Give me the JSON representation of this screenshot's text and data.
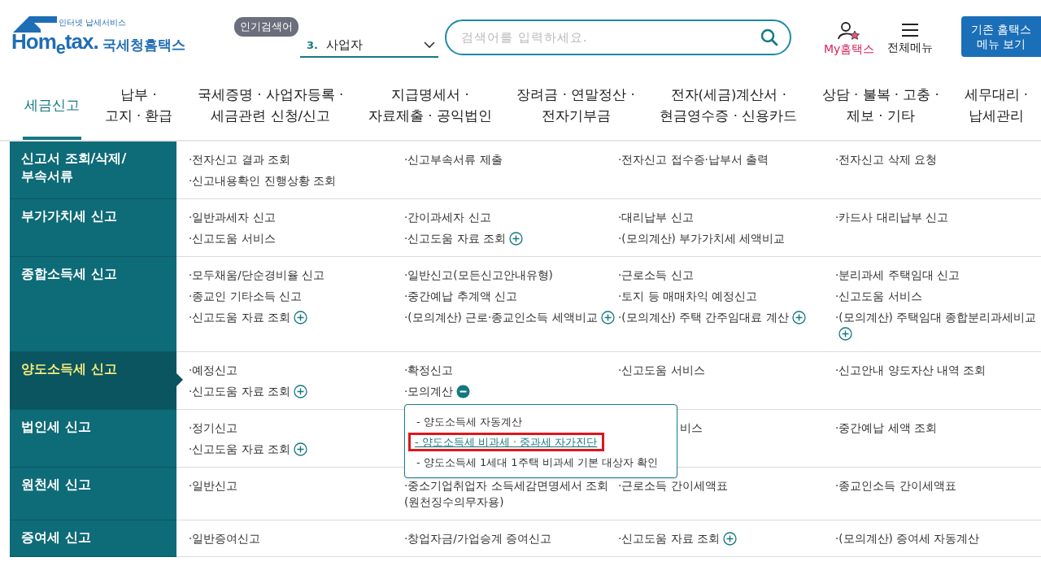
{
  "logo": {
    "tagline": "인터넷 납세서비스",
    "wordmark": "Hom$_{e}$tax.",
    "name": "국세청홈택스"
  },
  "popular": {
    "badge": "인기검색어",
    "rank": "3.",
    "term": "사업자"
  },
  "search": {
    "placeholder": "검색어를 입력하세요."
  },
  "my_link": "My홈택스",
  "menu_link": "전체메뉴",
  "legacy_button": "기존 홈택스\n메뉴 보기",
  "tabs": [
    {
      "label": "세금신고",
      "selected": true
    },
    {
      "label": "납부 ·\n고지 · 환급",
      "selected": false
    },
    {
      "label": "국세증명 · 사업자등록 ·\n세금관련 신청/신고",
      "selected": false
    },
    {
      "label": "지급명세서 ·\n자료제출 · 공익법인",
      "selected": false
    },
    {
      "label": "장려금 · 연말정산 ·\n전자기부금",
      "selected": false
    },
    {
      "label": "전자(세금)계산서 ·\n현금영수증 · 신용카드",
      "selected": false
    },
    {
      "label": "상담 · 불복 · 고충 ·\n제보 · 기타",
      "selected": false
    },
    {
      "label": "세무대리 ·\n납세관리",
      "selected": false
    }
  ],
  "sections": [
    {
      "title": "신고서 조회/삭제/\n부속서류",
      "selected": false,
      "columns": [
        [
          {
            "text": "·전자신고 결과 조회"
          },
          {
            "text": "·신고내용확인 진행상황 조회"
          }
        ],
        [
          {
            "text": "·신고부속서류 제출"
          }
        ],
        [
          {
            "text": "·전자신고 접수증·납부서 출력"
          }
        ],
        [
          {
            "text": "·전자신고 삭제 요청"
          }
        ]
      ]
    },
    {
      "title": "부가가치세 신고",
      "selected": false,
      "columns": [
        [
          {
            "text": "·일반과세자 신고"
          },
          {
            "text": "·신고도움 서비스"
          }
        ],
        [
          {
            "text": "·간이과세자 신고"
          },
          {
            "text": "·신고도움 자료 조회",
            "expanded": false
          }
        ],
        [
          {
            "text": "·대리납부 신고"
          },
          {
            "text": "·(모의계산) 부가가치세 세액비교"
          }
        ],
        [
          {
            "text": "·카드사 대리납부 신고"
          }
        ]
      ]
    },
    {
      "title": "종합소득세 신고",
      "selected": false,
      "columns": [
        [
          {
            "text": "·모두채움/단순경비율 신고"
          },
          {
            "text": "·종교인 기타소득 신고"
          },
          {
            "text": "·신고도움 자료 조회",
            "expanded": false
          }
        ],
        [
          {
            "text": "·일반신고(모든신고안내유형)"
          },
          {
            "text": "·중간예납 추계액 신고"
          },
          {
            "text": "·(모의계산) 근로·종교인소득 세액비교",
            "expanded": false
          }
        ],
        [
          {
            "text": "·근로소득 신고"
          },
          {
            "text": "·토지 등 매매차익 예정신고"
          },
          {
            "text": "·(모의계산) 주택 간주임대료 계산",
            "expanded": false
          }
        ],
        [
          {
            "text": "·분리과세 주택임대 신고"
          },
          {
            "text": "·신고도움 서비스"
          },
          {
            "text": "·(모의계산) 주택임대 종합분리과세비교",
            "expanded": false
          }
        ]
      ]
    },
    {
      "title": "양도소득세 신고",
      "selected": true,
      "columns": [
        [
          {
            "text": "·예정신고"
          },
          {
            "text": "·신고도움 자료 조회",
            "expanded": false
          }
        ],
        [
          {
            "text": "·확정신고"
          },
          {
            "text": "·모의계산",
            "expanded": true,
            "submenu": [
              {
                "text": "- 양도소득세 자동계산",
                "highlighted": false
              },
              {
                "text": "- 양도소득세 비과세 · 중과세 자가진단",
                "highlighted": true
              },
              {
                "text": "- 양도소득세 1세대 1주택 비과세 기본 대상자 확인",
                "highlighted": false
              }
            ]
          }
        ],
        [
          {
            "text": "·신고도움 서비스"
          }
        ],
        [
          {
            "text": "·신고안내 양도자산 내역 조회"
          }
        ]
      ]
    },
    {
      "title": "법인세 신고",
      "selected": false,
      "columns": [
        [
          {
            "text": "·정기신고"
          },
          {
            "text": "·신고도움 자료 조회",
            "expanded": false
          }
        ],
        [],
        [
          {
            "text": "비스",
            "kind": "covered"
          }
        ],
        [
          {
            "text": "·중간예납 세액 조회"
          }
        ]
      ]
    },
    {
      "title": "원천세 신고",
      "selected": false,
      "columns": [
        [
          {
            "text": "·일반신고"
          }
        ],
        [
          {
            "text": "·중소기업취업자 소득세감면명세서 조회\n(원천징수의무자용)"
          }
        ],
        [
          {
            "text": "·근로소득 간이세액표"
          }
        ],
        [
          {
            "text": "·종교인소득 간이세액표"
          }
        ]
      ]
    },
    {
      "title": "증여세 신고",
      "selected": false,
      "columns": [
        [
          {
            "text": "·일반증여신고"
          }
        ],
        [
          {
            "text": "·창업자금/가업승계 증여신고"
          }
        ],
        [
          {
            "text": "·신고도움 자료 조회",
            "expanded": false
          }
        ],
        [
          {
            "text": "·(모의계산) 증여세 자동계산"
          }
        ]
      ]
    }
  ]
}
